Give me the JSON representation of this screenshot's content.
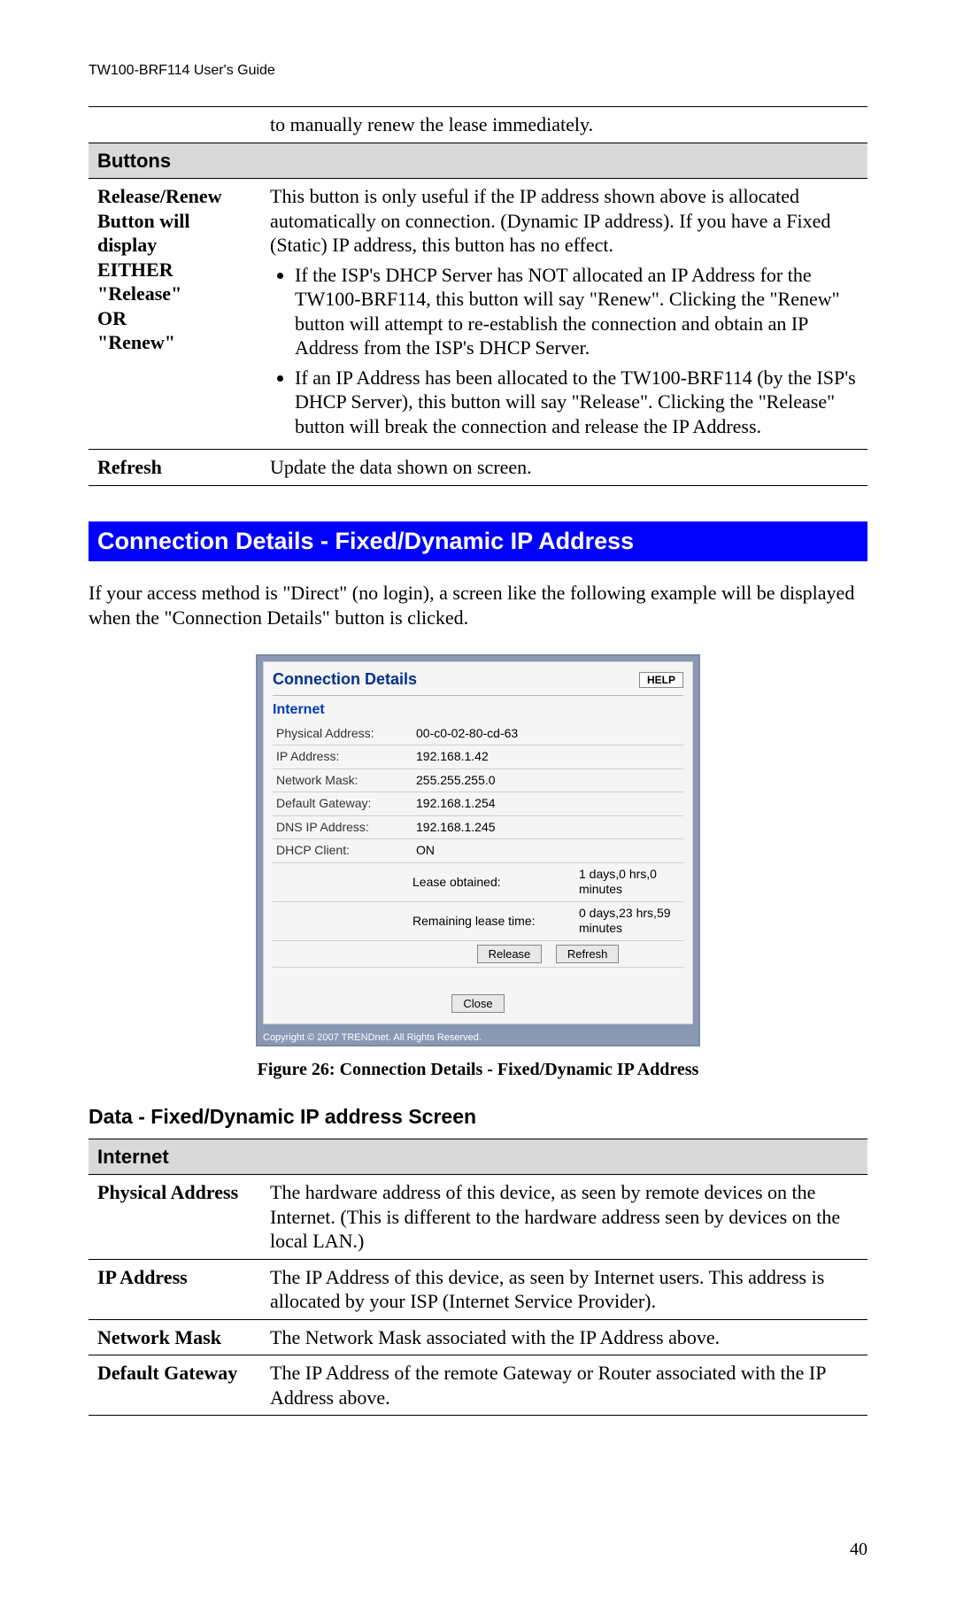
{
  "header": "TW100-BRF114 User's Guide",
  "page_number": "40",
  "top_table": {
    "carry_over_text": "to manually renew the lease immediately.",
    "section_header": "Buttons",
    "rows": [
      {
        "label_html": [
          "Release/Renew",
          "Button will display",
          "EITHER",
          "\"Release\"",
          "OR",
          "\"Renew\""
        ],
        "intro": "This button is only useful if the IP address shown above is allocated automatically on connection. (Dynamic IP address). If you have a Fixed (Static) IP address, this button has no effect.",
        "bullets": [
          "If the ISP's DHCP Server has NOT allocated an IP Address for the TW100-BRF114, this button will say \"Renew\". Clicking the \"Renew\" button will attempt to re-establish the connection and obtain an IP Address from the ISP's DHCP Server.",
          "If an IP Address has been allocated to the TW100-BRF114 (by the ISP's DHCP Server), this button will say \"Release\". Clicking the \"Release\" button will break the connection and release the IP Address."
        ]
      },
      {
        "label": "Refresh",
        "desc": "Update the data shown on screen."
      }
    ]
  },
  "blue_heading": "Connection Details - Fixed/Dynamic IP Address",
  "intro_paragraph": "If your access method is \"Direct\" (no login), a screen like the following example will be displayed when the \"Connection Details\" button is clicked.",
  "dialog": {
    "title": "Connection Details",
    "help": "HELP",
    "section": "Internet",
    "rows": {
      "physical_address_k": "Physical Address:",
      "physical_address_v": "00-c0-02-80-cd-63",
      "ip_address_k": "IP Address:",
      "ip_address_v": "192.168.1.42",
      "network_mask_k": "Network Mask:",
      "network_mask_v": "255.255.255.0",
      "default_gateway_k": "Default Gateway:",
      "default_gateway_v": "192.168.1.254",
      "dns_ip_k": "DNS IP Address:",
      "dns_ip_v": "192.168.1.245",
      "dhcp_client_k": "DHCP Client:",
      "dhcp_client_v": "ON",
      "lease_obtained_k": "Lease obtained:",
      "lease_obtained_v": "1 days,0 hrs,0 minutes",
      "remaining_lease_k": "Remaining lease time:",
      "remaining_lease_v": "0 days,23 hrs,59 minutes"
    },
    "release_btn": "Release",
    "refresh_btn": "Refresh",
    "close_btn": "Close",
    "copyright": "Copyright © 2007 TRENDnet. All Rights Reserved."
  },
  "figure_caption": "Figure 26: Connection Details - Fixed/Dynamic IP Address",
  "sub_heading": "Data - Fixed/Dynamic IP address Screen",
  "bottom_table": {
    "section_header": "Internet",
    "rows": [
      {
        "label": "Physical Address",
        "desc": "The hardware address of this device, as seen by remote devices on the Internet. (This is different to the hardware address seen by devices on the local LAN.)"
      },
      {
        "label": "IP Address",
        "desc": "The IP Address of this device, as seen by Internet users. This address is allocated by your ISP (Internet Service Provider)."
      },
      {
        "label": "Network Mask",
        "desc": "The Network Mask associated with the IP Address above."
      },
      {
        "label": "Default Gateway",
        "desc": "The IP Address of the remote Gateway or Router associated with the IP Address above."
      }
    ]
  }
}
